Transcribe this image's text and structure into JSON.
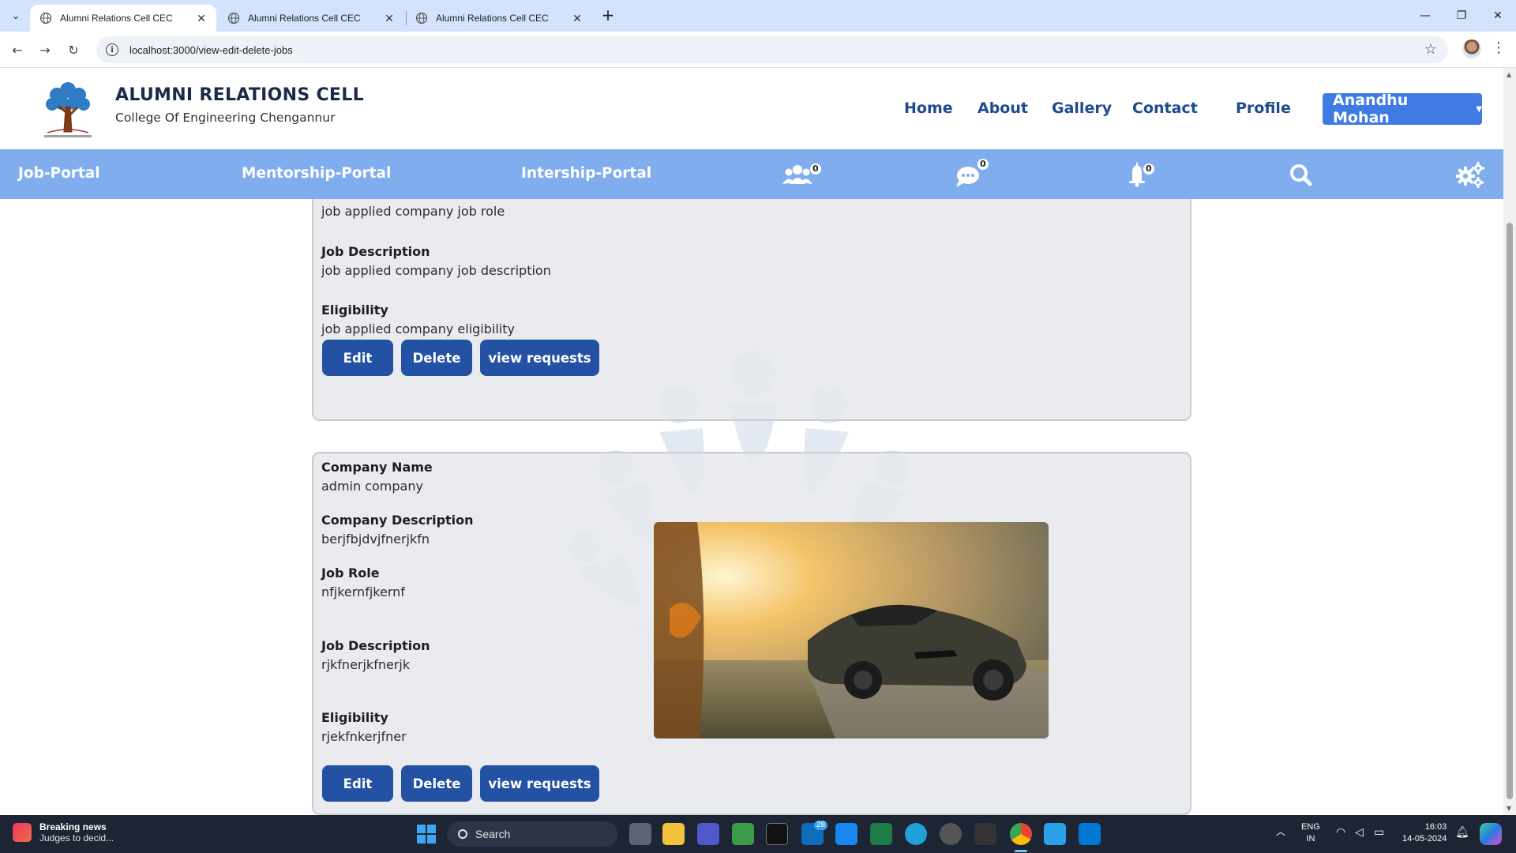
{
  "browser": {
    "tabs": [
      {
        "title": "Alumni Relations Cell CEC",
        "active": true
      },
      {
        "title": "Alumni Relations Cell CEC",
        "active": false
      },
      {
        "title": "Alumni Relations Cell CEC",
        "active": false
      }
    ],
    "url": "localhost:3000/view-edit-delete-jobs"
  },
  "header": {
    "title": "ALUMNI RELATIONS CELL",
    "subtitle": "College Of Engineering Chengannur",
    "nav": [
      "Home",
      "About",
      "Gallery",
      "Contact",
      "Profile"
    ],
    "user": "Anandhu Mohan"
  },
  "subnav": {
    "links": [
      "Job-Portal",
      "Mentorship-Portal",
      "Intership-Portal"
    ],
    "badges": {
      "groups": "0",
      "messages": "0",
      "notifications": "0"
    }
  },
  "jobs": [
    {
      "job_role_value": "job applied company job role",
      "job_description_label": "Job Description",
      "job_description": "job applied company job description",
      "eligibility_label": "Eligibility",
      "eligibility": "job applied company eligibility"
    },
    {
      "company_name_label": "Company Name",
      "company_name": "admin company",
      "company_description_label": "Company Description",
      "company_description": "berjfbjdvjfnerjkfn",
      "job_role_label": "Job Role",
      "job_role": "nfjkernfjkernf",
      "job_description_label": "Job Description",
      "job_description": "rjkfnerjkfnerjk",
      "eligibility_label": "Eligibility",
      "eligibility": "rjekfnkerjfner"
    }
  ],
  "buttons": {
    "edit": "Edit",
    "delete": "Delete",
    "view_requests": "view requests"
  },
  "taskbar": {
    "news_title": "Breaking news",
    "news_sub": "Judges to decid...",
    "search_placeholder": "Search",
    "mail_count": "28",
    "lang_top": "ENG",
    "lang_bottom": "IN",
    "time": "16:03",
    "date": "14-05-2024"
  },
  "colors": {
    "subnav_bg": "#7fadee",
    "button_bg": "#2351a3",
    "user_button_bg": "#3f7be4",
    "nav_text": "#1e4b8f"
  }
}
